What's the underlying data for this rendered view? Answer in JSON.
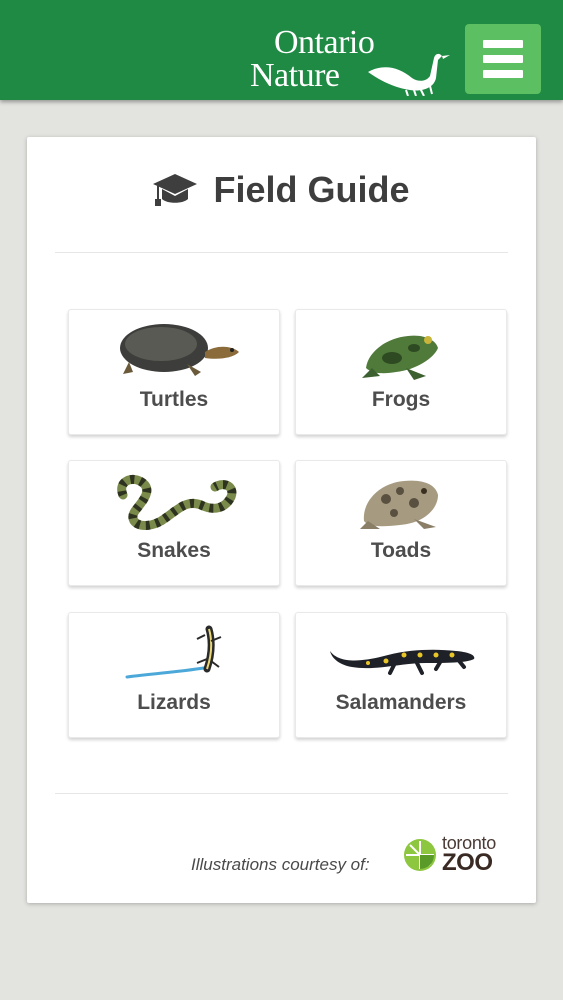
{
  "header": {
    "logo_line1": "Ontario",
    "logo_line2": "Nature",
    "brand_color": "#1f8a44",
    "menu_color": "#5cbf62"
  },
  "guide": {
    "title": "Field Guide",
    "title_icon": "graduation-cap-icon",
    "categories": [
      {
        "label": "Turtles",
        "icon": "turtle-icon"
      },
      {
        "label": "Frogs",
        "icon": "frog-icon"
      },
      {
        "label": "Snakes",
        "icon": "snake-icon"
      },
      {
        "label": "Toads",
        "icon": "toad-icon"
      },
      {
        "label": "Lizards",
        "icon": "lizard-icon"
      },
      {
        "label": "Salamanders",
        "icon": "salamander-icon"
      }
    ]
  },
  "footer": {
    "credit": "Illustrations courtesy of:",
    "zoo_line1": "toronto",
    "zoo_line2": "ZOO"
  }
}
